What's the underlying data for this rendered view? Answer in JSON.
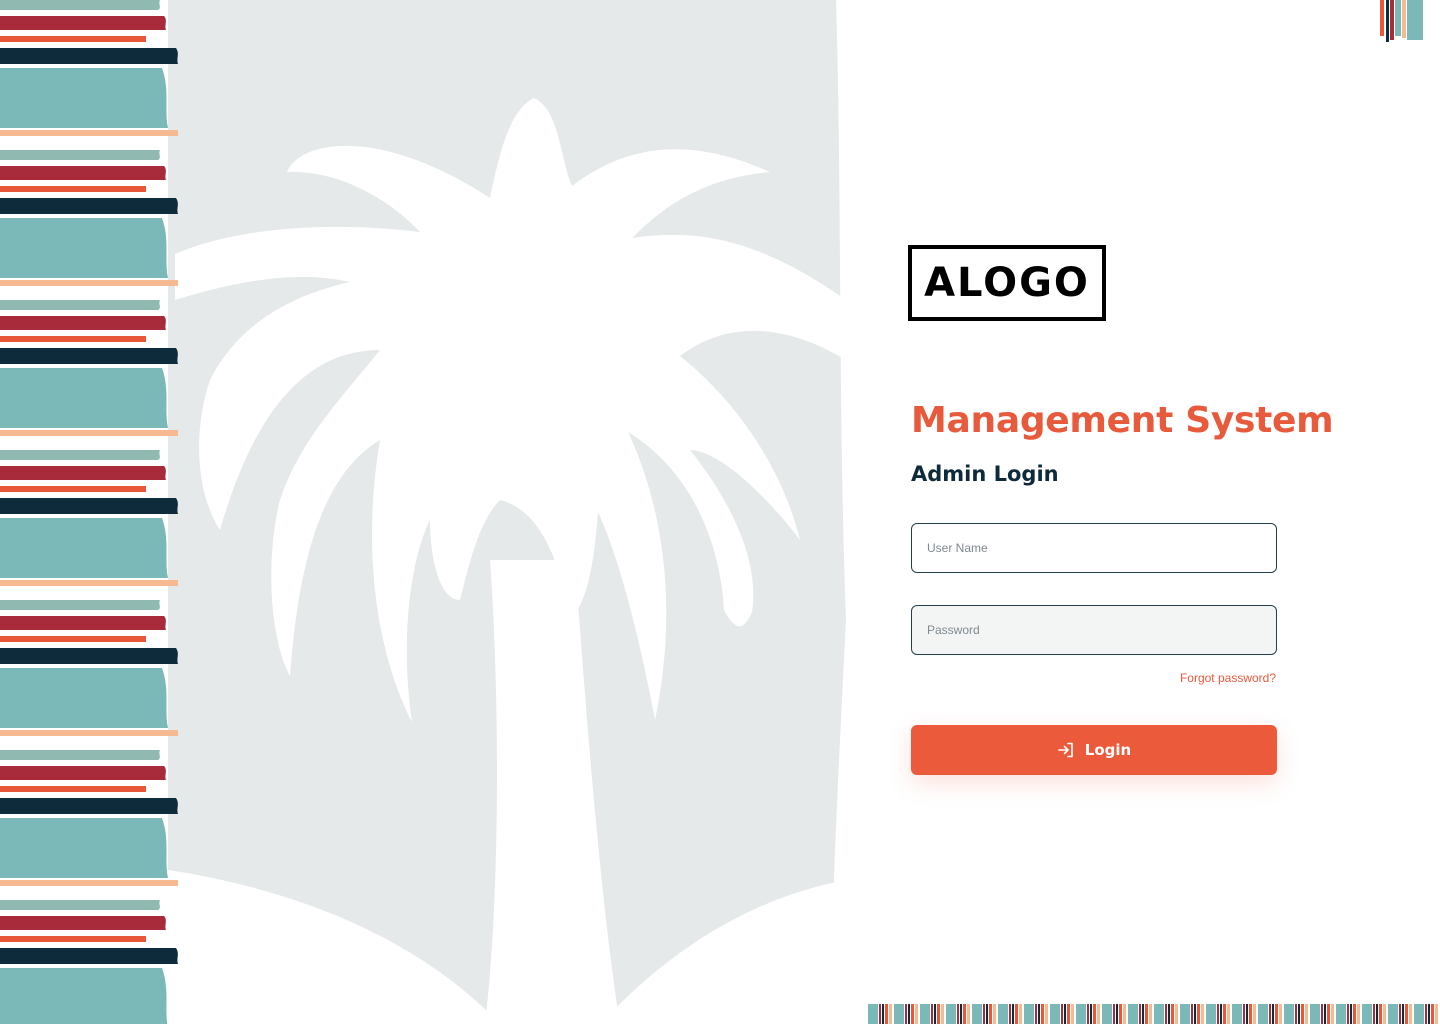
{
  "brand": {
    "logo_text": "ALOGO"
  },
  "page": {
    "title": "Management System",
    "subtitle": "Admin Login"
  },
  "form": {
    "username": {
      "placeholder": "User Name",
      "value": ""
    },
    "password": {
      "placeholder": "Password",
      "value": ""
    },
    "forgot_label": "Forgot password?",
    "login_label": "Login"
  },
  "colors": {
    "accent": "#ea5a3b",
    "heading": "#0f2a3a",
    "teal": "#7ab9b7",
    "navy": "#0d2b3b",
    "crimson": "#a82b3b",
    "peach": "#f7b992",
    "hero_bg": "#e6e9ea"
  },
  "icons": {
    "login": "login-arrow-icon",
    "hero": "palm-tree-icon"
  }
}
